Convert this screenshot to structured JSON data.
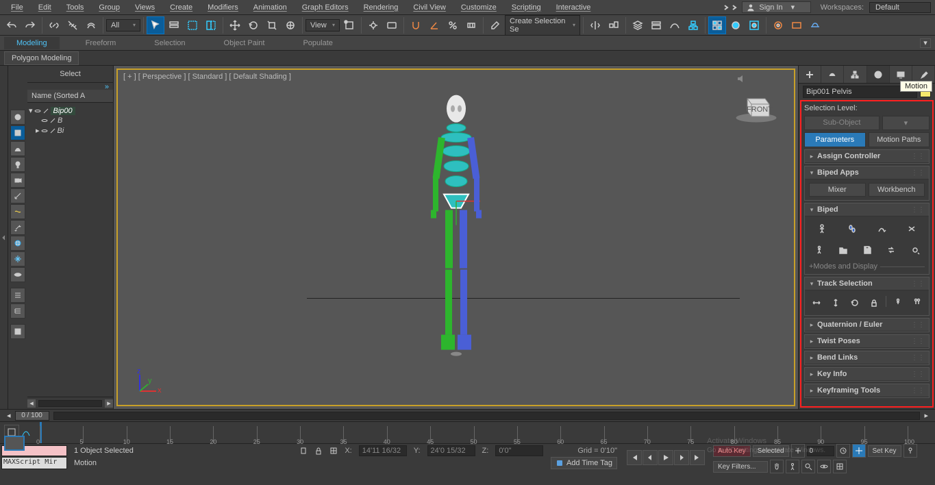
{
  "menu": [
    "File",
    "Edit",
    "Tools",
    "Group",
    "Views",
    "Create",
    "Modifiers",
    "Animation",
    "Graph Editors",
    "Rendering",
    "Civil View",
    "Customize",
    "Scripting",
    "Interactive"
  ],
  "signin": "Sign In",
  "workspaces_label": "Workspaces:",
  "workspace": "Default",
  "toolbar": {
    "all_drop": "All",
    "view_drop": "View",
    "sel_set": "Create Selection Se"
  },
  "ribbon_tabs": [
    "Modeling",
    "Freeform",
    "Selection",
    "Object Paint",
    "Populate"
  ],
  "ribbon_sub": "Polygon Modeling",
  "left_header": "Select",
  "tree_header": "Name (Sorted A",
  "tree_items": {
    "root": "Bip00",
    "child1": "B",
    "child2": "Bi"
  },
  "viewport_label": "[ + ] [ Perspective ] [ Standard ] [ Default Shading ]",
  "viewcube_face": "FRONT",
  "right": {
    "object": "Bip001 Pelvis",
    "tooltip": "Motion",
    "selection_level": "Selection Level:",
    "sub_object": "Sub-Object",
    "parameters": "Parameters",
    "motion_paths": "Motion Paths",
    "rollouts": {
      "assign": "Assign Controller",
      "biped_apps": "Biped Apps",
      "mixer": "Mixer",
      "workbench": "Workbench",
      "biped": "Biped",
      "modes": "+Modes and Display",
      "track_sel": "Track Selection",
      "quat": "Quaternion / Euler",
      "twist": "Twist Poses",
      "bend": "Bend Links",
      "keyinfo": "Key Info",
      "keyfr": "Keyframing Tools"
    }
  },
  "frame": "0 / 100",
  "timeline_ticks": [
    0,
    5,
    10,
    15,
    20,
    25,
    30,
    35,
    40,
    45,
    50,
    55,
    60,
    65,
    70,
    75,
    80,
    85,
    90,
    95,
    100
  ],
  "status": {
    "selected": "1 Object Selected",
    "motion": "Motion",
    "script": "MAXScript Mir",
    "x": "14'11 16/32",
    "y": "24'0 15/32",
    "z": "0'0\"",
    "grid": "Grid = 0'10\"",
    "add_tag": "Add Time Tag",
    "auto_key": "Auto Key",
    "selected_btn": "Selected",
    "set_key": "Set Key",
    "key_filters": "Key Filters...",
    "frame_spin": "0"
  },
  "watermark": {
    "l1": "Activate Windows",
    "l2": "Go to PC settings to activate Windows."
  }
}
